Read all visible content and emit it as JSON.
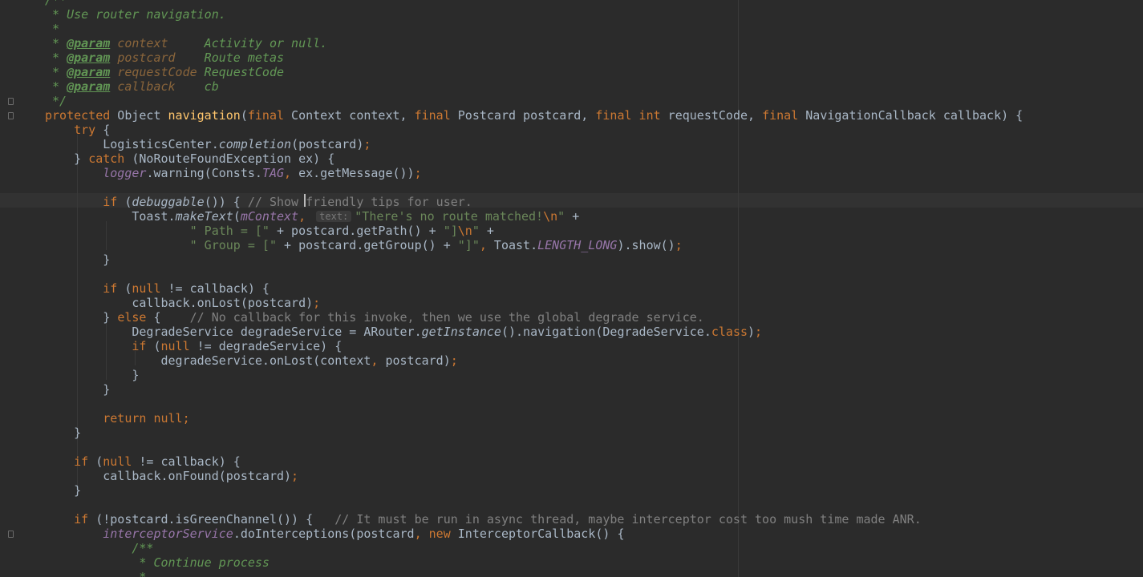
{
  "editor": {
    "language": "Java",
    "theme": "Darcula",
    "cursor_line_index": 13
  },
  "colors": {
    "background": "#2b2b2b",
    "keyword": "#cc7832",
    "method_declaration": "#ffc66d",
    "comment": "#808080",
    "doc_comment": "#629755",
    "string": "#6a8759",
    "field": "#9876aa",
    "default_text": "#a9b7c6"
  },
  "lines": [
    [
      [
        "doc",
        "/**"
      ]
    ],
    [
      [
        "doc",
        " * Use router navigation."
      ]
    ],
    [
      [
        "doc",
        " *"
      ]
    ],
    [
      [
        "doc",
        " * "
      ],
      [
        "tag",
        "@param"
      ],
      [
        "doc",
        " "
      ],
      [
        "pname",
        "context"
      ],
      [
        "doc",
        "     Activity or null."
      ]
    ],
    [
      [
        "doc",
        " * "
      ],
      [
        "tag",
        "@param"
      ],
      [
        "doc",
        " "
      ],
      [
        "pname",
        "postcard"
      ],
      [
        "doc",
        "    Route metas"
      ]
    ],
    [
      [
        "doc",
        " * "
      ],
      [
        "tag",
        "@param"
      ],
      [
        "doc",
        " "
      ],
      [
        "pname",
        "requestCode"
      ],
      [
        "doc",
        " RequestCode"
      ]
    ],
    [
      [
        "doc",
        " * "
      ],
      [
        "tag",
        "@param"
      ],
      [
        "doc",
        " "
      ],
      [
        "pname",
        "callback"
      ],
      [
        "doc",
        "    cb"
      ]
    ],
    [
      [
        "doc",
        " */"
      ]
    ],
    [
      [
        "kw",
        "protected"
      ],
      [
        "plain",
        " Object "
      ],
      [
        "fn",
        "navigation"
      ],
      [
        "plain",
        "("
      ],
      [
        "kw",
        "final"
      ],
      [
        "plain",
        " Context context, "
      ],
      [
        "kw",
        "final"
      ],
      [
        "plain",
        " Postcard postcard, "
      ],
      [
        "kw",
        "final int"
      ],
      [
        "plain",
        " requestCode, "
      ],
      [
        "kw",
        "final"
      ],
      [
        "plain",
        " NavigationCallback callback) {"
      ]
    ],
    [
      [
        "plain",
        "    "
      ],
      [
        "kw",
        "try"
      ],
      [
        "plain",
        " {"
      ]
    ],
    [
      [
        "plain",
        "        LogisticsCenter."
      ],
      [
        "ital",
        "completion"
      ],
      [
        "plain",
        "(postcard)"
      ],
      [
        "kw",
        ";"
      ]
    ],
    [
      [
        "plain",
        "    } "
      ],
      [
        "kw",
        "catch"
      ],
      [
        "plain",
        " (NoRouteFoundException ex) {"
      ]
    ],
    [
      [
        "plain",
        "        "
      ],
      [
        "fld",
        "logger"
      ],
      [
        "plain",
        ".warning(Consts."
      ],
      [
        "fld",
        "TAG"
      ],
      [
        "kw",
        ","
      ],
      [
        "plain",
        " ex.getMessage())"
      ],
      [
        "kw",
        ";"
      ]
    ],
    [
      [
        "plain",
        ""
      ]
    ],
    [
      [
        "plain",
        "        "
      ],
      [
        "kw",
        "if"
      ],
      [
        "plain",
        " ("
      ],
      [
        "ital",
        "debuggable"
      ],
      [
        "plain",
        "()) { "
      ],
      [
        "cmt",
        "// Show friendly tips for user."
      ]
    ],
    [
      [
        "plain",
        "            Toast."
      ],
      [
        "ital",
        "makeText"
      ],
      [
        "plain",
        "("
      ],
      [
        "fld",
        "mContext"
      ],
      [
        "kw",
        ","
      ],
      [
        "plain",
        " "
      ],
      [
        "hint",
        "text:"
      ],
      [
        "str",
        "\"There's no route matched!"
      ],
      [
        "esc",
        "\\n"
      ],
      [
        "str",
        "\""
      ],
      [
        "plain",
        " +"
      ]
    ],
    [
      [
        "plain",
        "                    "
      ],
      [
        "str",
        "\" Path = [\""
      ],
      [
        "plain",
        " + postcard.getPath() + "
      ],
      [
        "str",
        "\"]"
      ],
      [
        "esc",
        "\\n"
      ],
      [
        "str",
        "\""
      ],
      [
        "plain",
        " +"
      ]
    ],
    [
      [
        "plain",
        "                    "
      ],
      [
        "str",
        "\" Group = [\""
      ],
      [
        "plain",
        " + postcard.getGroup() + "
      ],
      [
        "str",
        "\"]\""
      ],
      [
        "kw",
        ","
      ],
      [
        "plain",
        " Toast."
      ],
      [
        "fld",
        "LENGTH_LONG"
      ],
      [
        "plain",
        ").show()"
      ],
      [
        "kw",
        ";"
      ]
    ],
    [
      [
        "plain",
        "        }"
      ]
    ],
    [
      [
        "plain",
        ""
      ]
    ],
    [
      [
        "plain",
        "        "
      ],
      [
        "kw",
        "if"
      ],
      [
        "plain",
        " ("
      ],
      [
        "kw",
        "null"
      ],
      [
        "plain",
        " != callback) {"
      ]
    ],
    [
      [
        "plain",
        "            callback.onLost(postcard)"
      ],
      [
        "kw",
        ";"
      ]
    ],
    [
      [
        "plain",
        "        } "
      ],
      [
        "kw",
        "else"
      ],
      [
        "plain",
        " {    "
      ],
      [
        "cmt",
        "// No callback for this invoke, then we use the global degrade service."
      ]
    ],
    [
      [
        "plain",
        "            DegradeService degradeService = ARouter."
      ],
      [
        "ital",
        "getInstance"
      ],
      [
        "plain",
        "().navigation(DegradeService."
      ],
      [
        "kw",
        "class"
      ],
      [
        "plain",
        ")"
      ],
      [
        "kw",
        ";"
      ]
    ],
    [
      [
        "plain",
        "            "
      ],
      [
        "kw",
        "if"
      ],
      [
        "plain",
        " ("
      ],
      [
        "kw",
        "null"
      ],
      [
        "plain",
        " != degradeService) {"
      ]
    ],
    [
      [
        "plain",
        "                degradeService.onLost(context"
      ],
      [
        "kw",
        ","
      ],
      [
        "plain",
        " postcard)"
      ],
      [
        "kw",
        ";"
      ]
    ],
    [
      [
        "plain",
        "            }"
      ]
    ],
    [
      [
        "plain",
        "        }"
      ]
    ],
    [
      [
        "plain",
        ""
      ]
    ],
    [
      [
        "plain",
        "        "
      ],
      [
        "kw",
        "return null;"
      ]
    ],
    [
      [
        "plain",
        "    }"
      ]
    ],
    [
      [
        "plain",
        ""
      ]
    ],
    [
      [
        "plain",
        "    "
      ],
      [
        "kw",
        "if"
      ],
      [
        "plain",
        " ("
      ],
      [
        "kw",
        "null"
      ],
      [
        "plain",
        " != callback) {"
      ]
    ],
    [
      [
        "plain",
        "        callback.onFound(postcard)"
      ],
      [
        "kw",
        ";"
      ]
    ],
    [
      [
        "plain",
        "    }"
      ]
    ],
    [
      [
        "plain",
        ""
      ]
    ],
    [
      [
        "plain",
        "    "
      ],
      [
        "kw",
        "if"
      ],
      [
        "plain",
        " (!postcard.isGreenChannel()) {   "
      ],
      [
        "cmt",
        "// It must be run in async thread, maybe interceptor cost too mush time made ANR."
      ]
    ],
    [
      [
        "plain",
        "        "
      ],
      [
        "fld",
        "interceptorService"
      ],
      [
        "plain",
        ".doInterceptions(postcard"
      ],
      [
        "kw",
        ","
      ],
      [
        "plain",
        " "
      ],
      [
        "kw",
        "new"
      ],
      [
        "plain",
        " InterceptorCallback() {"
      ]
    ],
    [
      [
        "plain",
        "            "
      ],
      [
        "doc",
        "/**"
      ]
    ],
    [
      [
        "plain",
        "            "
      ],
      [
        "doc",
        " * Continue process"
      ]
    ],
    [
      [
        "plain",
        "            "
      ],
      [
        "doc",
        " *"
      ]
    ]
  ]
}
